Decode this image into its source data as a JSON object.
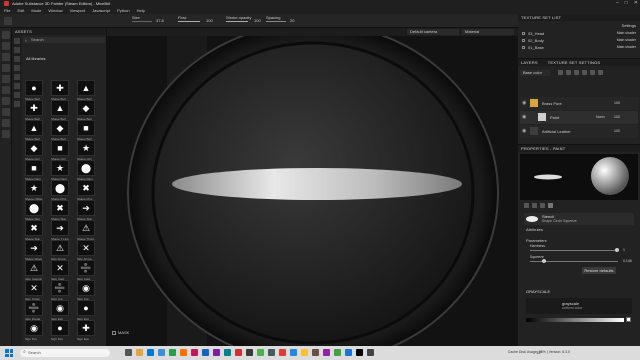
{
  "window": {
    "title": "Adobe Substance 3D Painter (Steam Edition) - Mixellbit",
    "controls": [
      "–",
      "□",
      "✕"
    ]
  },
  "menu": [
    "File",
    "Edit",
    "Mode",
    "Window",
    "Viewport",
    "Javascript",
    "Python",
    "Help"
  ],
  "toolbar": {
    "size_label": "Size",
    "size_value": "37.8",
    "flow_label": "Flow",
    "flow_value": "100",
    "stroke_label": "Stroke opacity",
    "stroke_value": "100",
    "spacing_label": "Spacing",
    "spacing_value": "20"
  },
  "assets": {
    "header": "ASSETS",
    "search_placeholder": "Search",
    "library": "All libraries",
    "items": [
      [
        "Shape Bell",
        "Shape Bell",
        "Shape Bell"
      ],
      [
        "Shape Bell",
        "Shape Bell",
        "Shape Bell"
      ],
      [
        "Shape Bell",
        "Shape Bell",
        "Shape Bell"
      ],
      [
        "Shape Circ",
        "Shape Circ",
        "Shape Circ"
      ],
      [
        "Shape Dam",
        "Shape Dam",
        "Shape Dam"
      ],
      [
        "Shape Offset",
        "Shape Pinc",
        "Shape Pinc"
      ],
      [
        "Shape Squ",
        "Shape Star",
        "Shape Star"
      ],
      [
        "Shape Star",
        "Shape T Line",
        "Shape Thorn"
      ],
      [
        "Shape Wave",
        "Sign Arrow",
        "Sign Arrow"
      ],
      [
        "Sign Caution",
        "Sign Caut",
        "Sign Caut"
      ],
      [
        "Sign Cross",
        "Sign Cut",
        "Sign Cut"
      ],
      [
        "Sign Divide",
        "Sign Exit",
        "Sign Exit"
      ],
      [
        "Sign Fire",
        "Sign Fire",
        "Sign Eye"
      ]
    ]
  },
  "viewport": {
    "camera": "Default camera",
    "mode": "Material",
    "mask_label": "MASK"
  },
  "texture_set_list": {
    "header": "TEXTURE SET LIST",
    "settings": "Settings",
    "items": [
      {
        "name": "03_Head",
        "shader": "Main shader"
      },
      {
        "name": "02_Body",
        "shader": "Main shader"
      },
      {
        "name": "01_Base",
        "shader": "Main shader"
      }
    ]
  },
  "layers": {
    "header": "LAYERS",
    "tab2": "TEXTURE SET SETTINGS",
    "base_color": "Base color",
    "items": [
      {
        "name": "Brass Pure",
        "blend": "",
        "opacity": "100"
      },
      {
        "name": "Paint",
        "blend": "Norm",
        "opacity": "100"
      },
      {
        "name": "Artificial Leather",
        "blend": "",
        "opacity": "100"
      }
    ]
  },
  "properties": {
    "header": "PROPERTIES - PAINT",
    "stencil_label": "Stencil",
    "stencil_value": "Shape Circle Squeeze",
    "attributes": "Attributes",
    "parameters": "Parameters",
    "hardness_label": "Hardness",
    "hardness_value": "1",
    "squeeze_label": "Squeeze",
    "squeeze_value": "0.146",
    "restore": "Restore defaults",
    "grayscale": "GRAYSCALE",
    "mode": "grayscale",
    "mode_sub": "uniform color"
  },
  "taskbar": {
    "search_placeholder": "Search",
    "status": "Cache Disk Usage:  95% | Version: 8.3.0",
    "time": "",
    "temp": "15°"
  }
}
